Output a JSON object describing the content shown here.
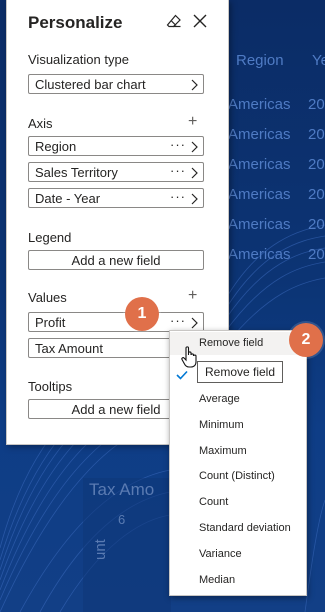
{
  "background": {
    "table_headers": [
      "Region",
      "Ye"
    ],
    "table_rows": [
      [
        "Americas",
        "20"
      ],
      [
        "Americas",
        "20"
      ],
      [
        "Americas",
        "20"
      ],
      [
        "Americas",
        "20"
      ],
      [
        "Americas",
        "20"
      ],
      [
        "Americas",
        "20"
      ]
    ],
    "ghost_title": "Tax Amo",
    "ghost_value": "6",
    "ghost_side": "unt"
  },
  "pane": {
    "title": "Personalize",
    "visualization_label": "Visualization type",
    "visualization_value": "Clustered bar chart",
    "axis_label": "Axis",
    "axis_fields": [
      "Region",
      "Sales Territory",
      "Date - Year"
    ],
    "legend_label": "Legend",
    "legend_add": "Add a new field",
    "values_label": "Values",
    "values_fields": [
      "Profit",
      "Tax Amount"
    ],
    "tooltips_label": "Tooltips",
    "tooltips_add": "Add a new field",
    "more_glyph": "···"
  },
  "badges": {
    "one": "1",
    "two": "2"
  },
  "menu": {
    "items": [
      "Remove field",
      "Average",
      "Minimum",
      "Maximum",
      "Count (Distinct)",
      "Count",
      "Standard deviation",
      "Variance",
      "Median"
    ],
    "tooltip": "Remove field"
  },
  "colors": {
    "accent": "#e0704a",
    "background": "#0c3474"
  },
  "icons": [
    "eraser-icon",
    "close-icon",
    "chevron-right-icon",
    "plus-icon",
    "checkmark-icon",
    "hand-cursor-icon"
  ]
}
